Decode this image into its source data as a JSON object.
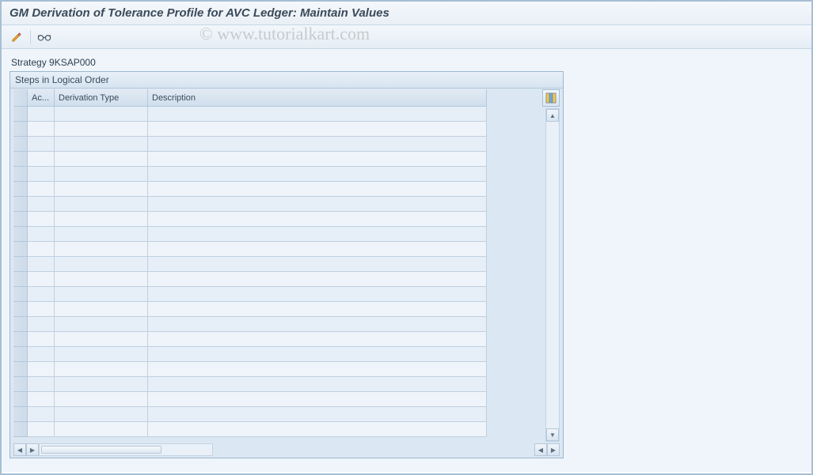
{
  "title": "GM Derivation of Tolerance Profile for AVC Ledger: Maintain Values",
  "toolbar": {
    "edit_icon": "pencil-icon",
    "glasses_icon": "glasses-icon"
  },
  "strategy": {
    "label": "Strategy",
    "value": "9KSAP000"
  },
  "panel": {
    "title": "Steps in Logical Order",
    "columns": {
      "ac": "Ac...",
      "derivation_type": "Derivation Type",
      "description": "Description"
    },
    "row_count": 22,
    "rows": [
      {
        "ac": "",
        "derivation_type": "",
        "description": ""
      },
      {
        "ac": "",
        "derivation_type": "",
        "description": ""
      },
      {
        "ac": "",
        "derivation_type": "",
        "description": ""
      },
      {
        "ac": "",
        "derivation_type": "",
        "description": ""
      },
      {
        "ac": "",
        "derivation_type": "",
        "description": ""
      },
      {
        "ac": "",
        "derivation_type": "",
        "description": ""
      },
      {
        "ac": "",
        "derivation_type": "",
        "description": ""
      },
      {
        "ac": "",
        "derivation_type": "",
        "description": ""
      },
      {
        "ac": "",
        "derivation_type": "",
        "description": ""
      },
      {
        "ac": "",
        "derivation_type": "",
        "description": ""
      },
      {
        "ac": "",
        "derivation_type": "",
        "description": ""
      },
      {
        "ac": "",
        "derivation_type": "",
        "description": ""
      },
      {
        "ac": "",
        "derivation_type": "",
        "description": ""
      },
      {
        "ac": "",
        "derivation_type": "",
        "description": ""
      },
      {
        "ac": "",
        "derivation_type": "",
        "description": ""
      },
      {
        "ac": "",
        "derivation_type": "",
        "description": ""
      },
      {
        "ac": "",
        "derivation_type": "",
        "description": ""
      },
      {
        "ac": "",
        "derivation_type": "",
        "description": ""
      },
      {
        "ac": "",
        "derivation_type": "",
        "description": ""
      },
      {
        "ac": "",
        "derivation_type": "",
        "description": ""
      },
      {
        "ac": "",
        "derivation_type": "",
        "description": ""
      },
      {
        "ac": "",
        "derivation_type": "",
        "description": ""
      }
    ]
  },
  "watermark": "© www.tutorialkart.com"
}
